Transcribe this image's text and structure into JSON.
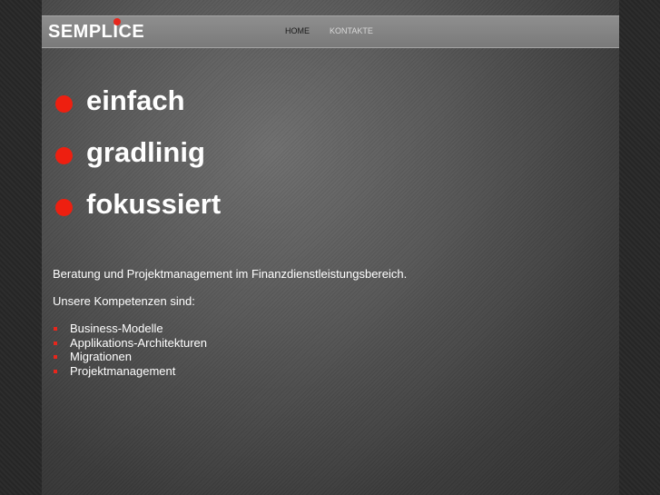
{
  "header": {
    "logo": "SEMPLICE",
    "nav": [
      {
        "label": "HOME"
      },
      {
        "label": "KONTAKTE"
      }
    ]
  },
  "taglines": [
    "einfach",
    "gradlinig",
    "fokussiert"
  ],
  "main": {
    "intro": "Beratung und Projektmanagement im Finanzdienstleistungsbereich.",
    "competences_label": "Unsere Kompetenzen sind:",
    "competences": [
      "Business-Modelle",
      "Applikations-Architekturen",
      "Migrationen",
      "Projektmanagement"
    ]
  },
  "colors": {
    "accent": "#e8261c",
    "topbar": "#858585",
    "background": "#2a2a2a"
  }
}
